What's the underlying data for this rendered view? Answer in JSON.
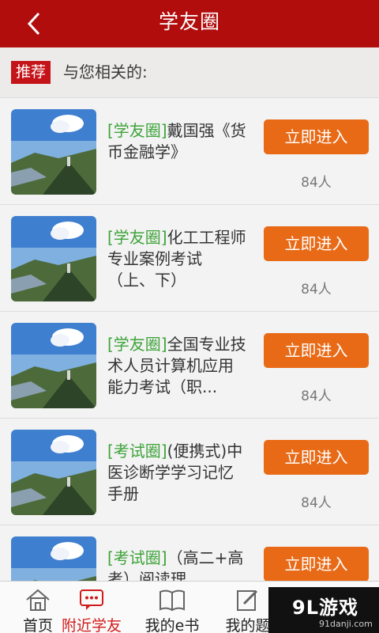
{
  "header": {
    "title": "学友圈"
  },
  "recommend": {
    "tag": "推荐",
    "text": "与您相关的:"
  },
  "items": [
    {
      "circle": "[学友圈]",
      "name": "戴国强《货币金融学》",
      "button": "立即进入",
      "count": "84人"
    },
    {
      "circle": "[学友圈]",
      "name": "化工工程师 专业案例考试（上、下）",
      "button": "立即进入",
      "count": "84人"
    },
    {
      "circle": "[学友圈]",
      "name": "全国专业技术人员计算机应用能力考试（职...",
      "button": "立即进入",
      "count": "84人"
    },
    {
      "circle": "[考试圈]",
      "name": "(便携式)中医诊断学学习记忆手册",
      "button": "立即进入",
      "count": "84人"
    },
    {
      "circle": "[考试圈]",
      "name": "（高二+高考）阅读理",
      "button": "立即进入",
      "count": ""
    }
  ],
  "tabs": [
    {
      "label": "首页",
      "icon": "home-icon"
    },
    {
      "label": "附近学友",
      "icon": "chat-icon"
    },
    {
      "label": "我的e书",
      "icon": "book-icon"
    },
    {
      "label": "我的题",
      "icon": "edit-icon"
    }
  ],
  "watermark": {
    "logo": "9L游戏",
    "site": "91danji.com"
  },
  "colors": {
    "header": "#b20d0d",
    "accent_button": "#e86a16",
    "circle_tag": "#3ea33a",
    "active_tab": "#d11a1a"
  }
}
